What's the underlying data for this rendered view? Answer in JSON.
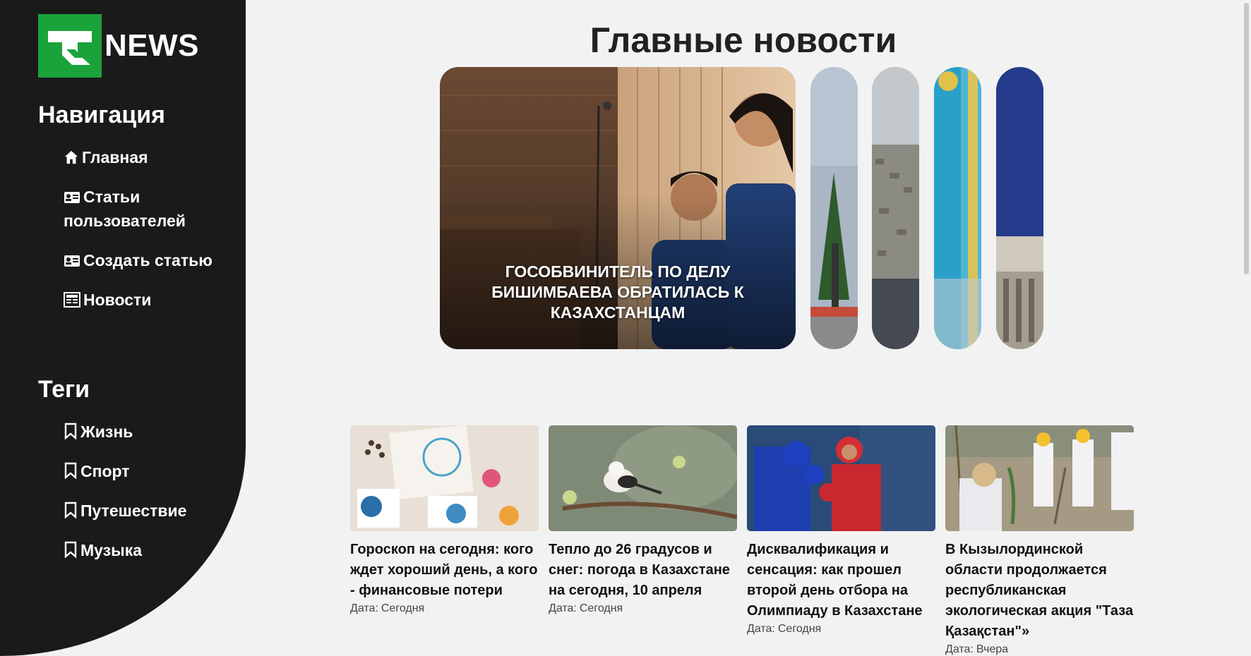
{
  "logo": {
    "text": "NEWS"
  },
  "sidebar": {
    "nav_title": "Навигация",
    "nav_items": [
      {
        "label": "Главная",
        "icon": "home-icon"
      },
      {
        "label": "Статьи пользователей",
        "icon": "id-card-icon"
      },
      {
        "label": "Создать статью",
        "icon": "id-card-icon"
      },
      {
        "label": "Новости",
        "icon": "newspaper-icon"
      }
    ],
    "tags_title": "Теги",
    "tag_items": [
      {
        "label": "Жизнь",
        "icon": "bookmark-icon"
      },
      {
        "label": "Спорт",
        "icon": "bookmark-icon"
      },
      {
        "label": "Путешествие",
        "icon": "bookmark-icon"
      },
      {
        "label": "Музыка",
        "icon": "bookmark-icon"
      }
    ]
  },
  "main": {
    "title": "Главные новости",
    "hero_caption": "ГОСОБВИНИТЕЛЬ ПО ДЕЛУ БИШИМБАЕВА ОБРАТИЛАСЬ К КАЗАХСТАНЦАМ",
    "cards": [
      {
        "title": "Гороскоп на сегодня: кого ждет хороший день, а кого - финансовые потери",
        "date_label": "Дата:",
        "date": "Сегодня"
      },
      {
        "title": "Тепло до 26 градусов и снег: погода в Казахстане на сегодня, 10 апреля",
        "date_label": "Дата:",
        "date": "Сегодня"
      },
      {
        "title": "Дисквалификация и сенсация: как прошел второй день отбора на Олимпиаду в Казахстане",
        "date_label": "Дата:",
        "date": "Сегодня"
      },
      {
        "title": "В Кызылординской области продолжается республиканская экологическая акция \"Таза Қазақстан\"»",
        "date_label": "Дата:",
        "date": "Вчера"
      }
    ]
  },
  "colors": {
    "sidebar_bg": "#1a1a1a",
    "logo_green": "#1aa33a",
    "page_bg": "#f2f2f2"
  }
}
